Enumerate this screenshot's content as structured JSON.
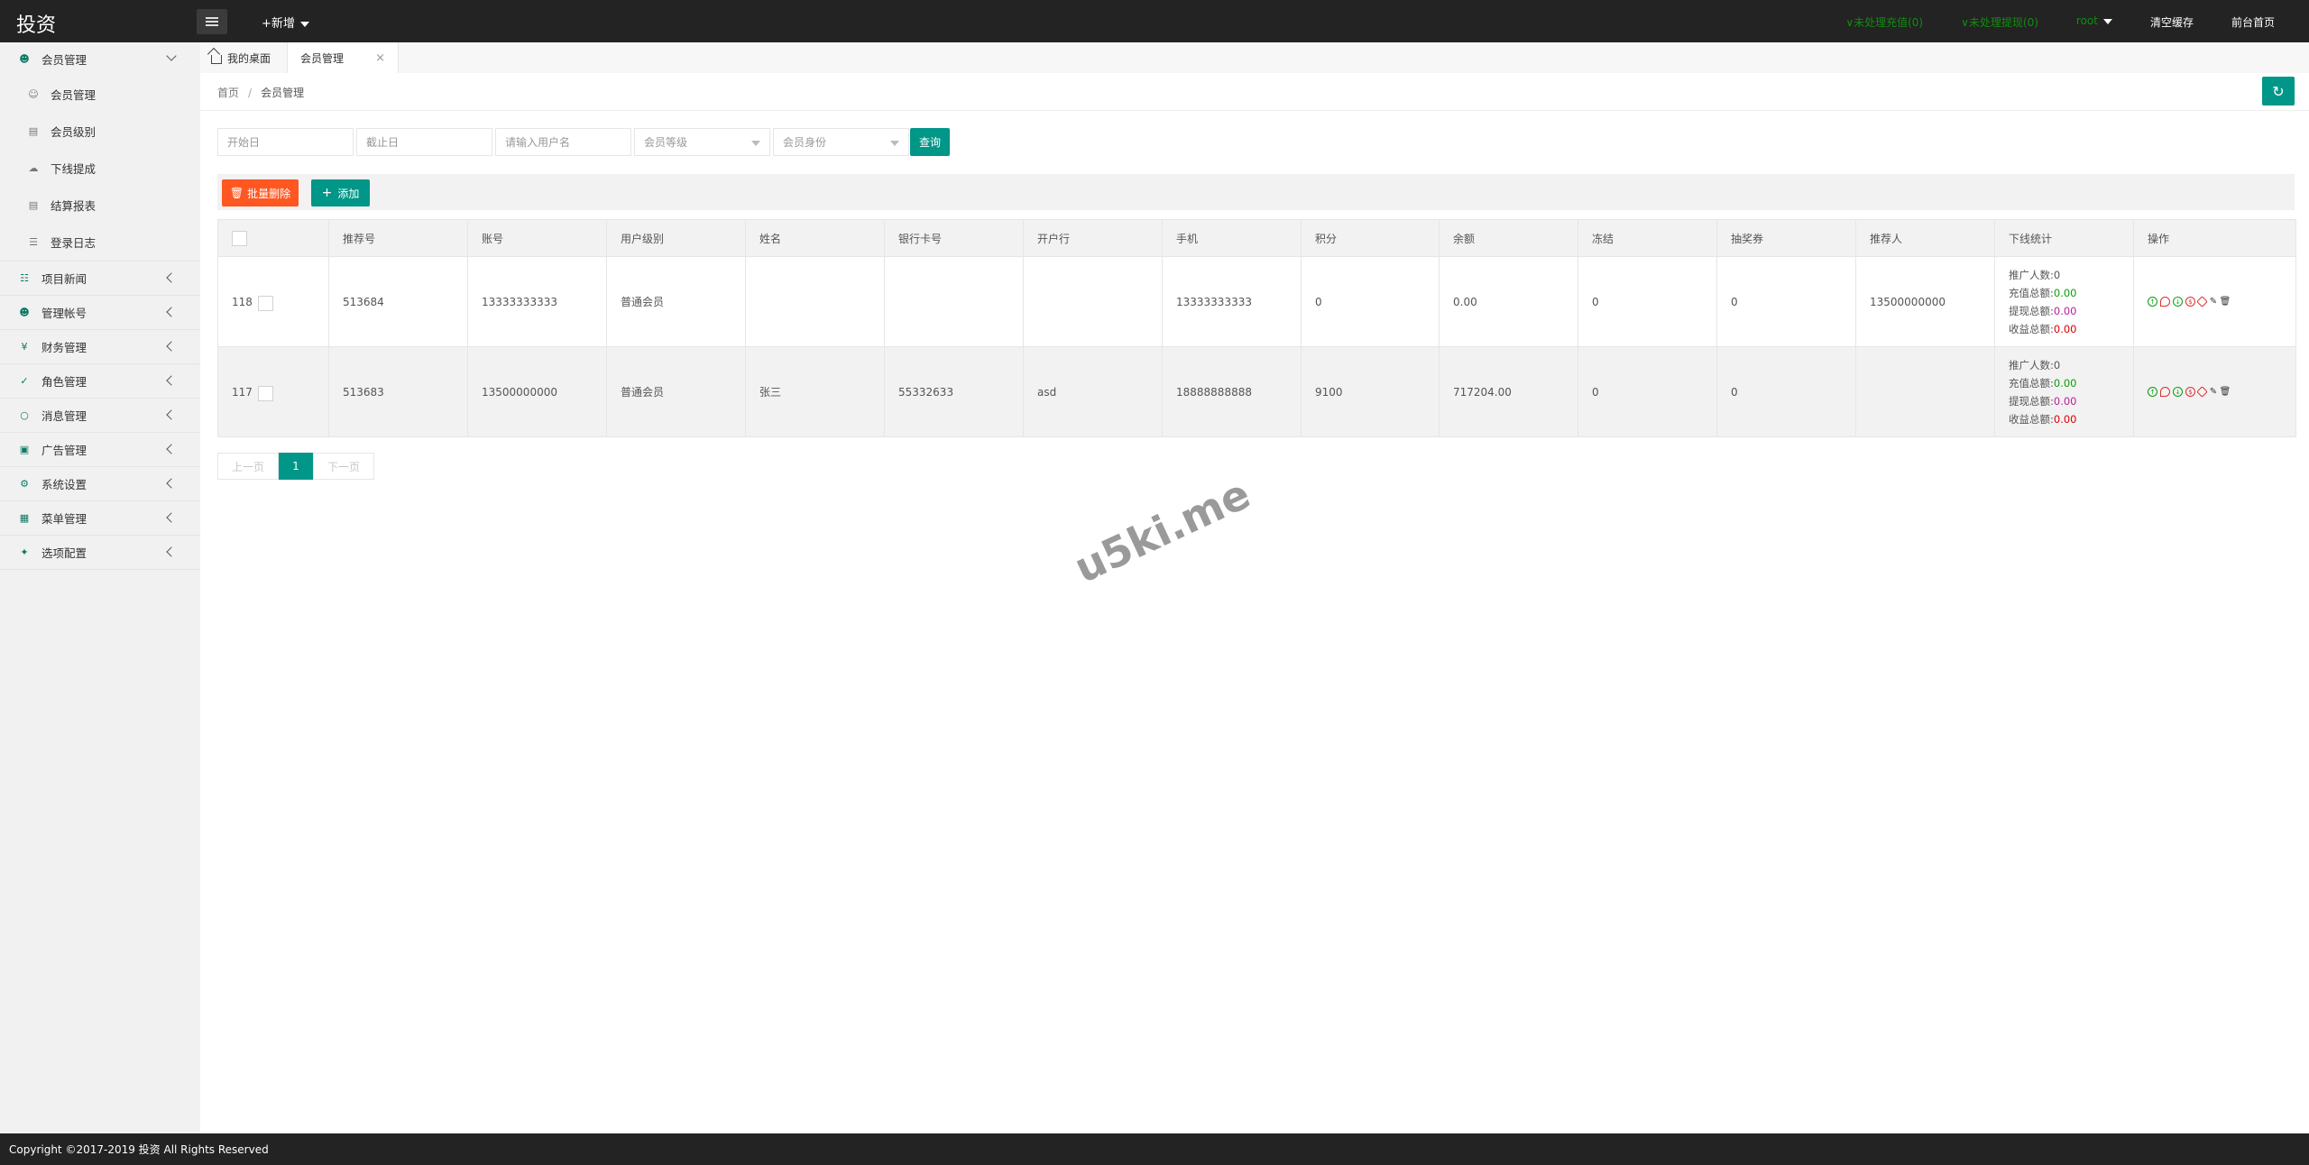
{
  "app": {
    "logo": "投资",
    "add_new": "+新增"
  },
  "topnav": {
    "pending_recharge": "∨未处理充值(0)",
    "pending_withdraw": "∨未处理提现(0)",
    "user": "root",
    "clear_cache": "清空缓存",
    "frontend_home": "前台首页"
  },
  "sidebar": {
    "member_mgmt": "会员管理",
    "sub_items": [
      "会员管理",
      "会员级别",
      "下线提成",
      "结算报表",
      "登录日志"
    ],
    "items": [
      "项目新闻",
      "管理帐号",
      "财务管理",
      "角色管理",
      "消息管理",
      "广告管理",
      "系统设置",
      "菜单管理",
      "选项配置"
    ]
  },
  "tabs": {
    "home": "我的桌面",
    "active": "会员管理",
    "close": "×"
  },
  "breadcrumb": {
    "home": "首页",
    "sep": "/",
    "current": "会员管理"
  },
  "filters": {
    "start_date": "开始日",
    "end_date": "截止日",
    "username": "请输入用户名",
    "level": "会员等级",
    "identity": "会员身份",
    "query": "查询"
  },
  "toolbar": {
    "batch_delete": "批量删除",
    "add": "添加"
  },
  "table": {
    "headers": [
      "",
      "推荐号",
      "账号",
      "用户级别",
      "姓名",
      "银行卡号",
      "开户行",
      "手机",
      "积分",
      "余额",
      "冻结",
      "抽奖券",
      "推荐人",
      "下线统计",
      "操作"
    ],
    "stats_labels": {
      "promo_count": "推广人数:",
      "recharge_total": "充值总额:",
      "withdraw_total": "提现总额:",
      "income_total": "收益总额:"
    },
    "rows": [
      {
        "id": "118",
        "ref_no": "513684",
        "account": "13333333333",
        "level": "普通会员",
        "name": "",
        "bank_card": "",
        "bank": "",
        "phone": "13333333333",
        "points": "0",
        "balance": "0.00",
        "frozen": "0",
        "lottery": "0",
        "referrer": "13500000000",
        "promo_count": "0",
        "recharge_total": "0.00",
        "withdraw_total": "0.00",
        "income_total": "0.00"
      },
      {
        "id": "117",
        "ref_no": "513683",
        "account": "13500000000",
        "level": "普通会员",
        "name": "张三",
        "bank_card": "55332633",
        "bank": "asd",
        "phone": "18888888888",
        "points": "9100",
        "balance": "717204.00",
        "frozen": "0",
        "lottery": "0",
        "referrer": "",
        "promo_count": "0",
        "recharge_total": "0.00",
        "withdraw_total": "0.00",
        "income_total": "0.00"
      }
    ]
  },
  "pager": {
    "prev": "上一页",
    "current": "1",
    "next": "下一页"
  },
  "watermark": "u5ki.me",
  "footer": "Copyright ©2017-2019 投资 All Rights Reserved",
  "colors": {
    "accent": "#009688",
    "danger": "#ff5722",
    "topbar": "#232323"
  }
}
